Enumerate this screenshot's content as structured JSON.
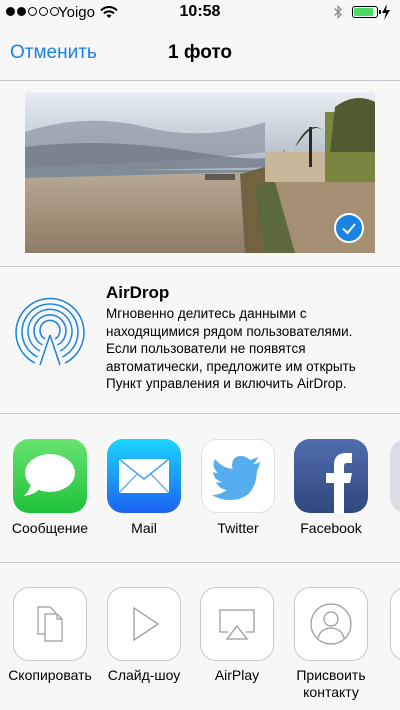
{
  "status": {
    "carrier": "Yoigo",
    "time": "10:58",
    "battery_level": 0.85,
    "signal_bars_filled": 2,
    "signal_bars_total": 5
  },
  "nav": {
    "cancel_label": "Отменить",
    "title": "1 фото"
  },
  "airdrop": {
    "title": "AirDrop",
    "description": "Мгновенно делитесь данными с\nнаходящимися рядом пользователями.\nЕсли пользователи не появятся\nавтоматически, предложите им открыть\nПункт управления и включить AirDrop."
  },
  "share_apps": [
    {
      "label": "Сообщение",
      "icon": "messages-icon",
      "color": "#4cd964"
    },
    {
      "label": "Mail",
      "icon": "mail-icon",
      "color": "#1d8df3"
    },
    {
      "label": "Twitter",
      "icon": "twitter-icon",
      "color": "#55acee"
    },
    {
      "label": "Facebook",
      "icon": "facebook-icon",
      "color": "#3b5998"
    }
  ],
  "actions": [
    {
      "label": "Скопировать",
      "icon": "copy-icon"
    },
    {
      "label": "Слайд-шоу",
      "icon": "slideshow-icon"
    },
    {
      "label": "AirPlay",
      "icon": "airplay-icon"
    },
    {
      "label": "Присвоить\nконтакту",
      "icon": "assign-contact-icon"
    }
  ],
  "colors": {
    "accent": "#1a82e2",
    "separator": "#c8c7cc",
    "battery": "#4cd964"
  }
}
